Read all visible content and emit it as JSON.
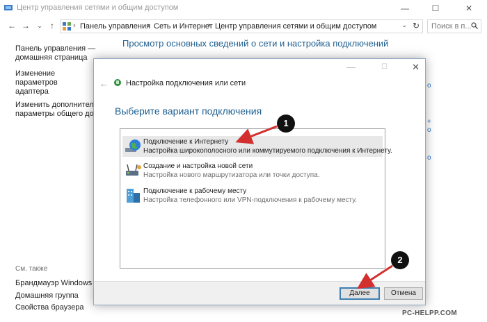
{
  "window": {
    "title": "Центр управления сетями и общим доступом",
    "minimize": "—",
    "maximize": "☐",
    "close": "✕"
  },
  "addressbar": {
    "back": "←",
    "forward": "→",
    "dropdown": "⌄",
    "up": "↑",
    "crumbs": [
      "Панель управления",
      "Сеть и Интернет",
      "Центр управления сетями и общим доступом"
    ],
    "separator": "›",
    "refresh": "↻",
    "search_placeholder": "Поиск в п..."
  },
  "left_pane": {
    "home_link_line1": "Панель управления —",
    "home_link_line2": "домашняя страница",
    "adapter_line1": "Изменение параметров",
    "adapter_line2": "адаптера",
    "sharing_line1": "Изменить дополнительные",
    "sharing_line2": "параметры общего досту",
    "see_also": "См. также",
    "see_also_items": [
      "Брандмауэр Windows",
      "Домашняя группа",
      "Свойства браузера"
    ]
  },
  "main": {
    "heading": "Просмотр основных сведений о сети и настройка подключений"
  },
  "dialog": {
    "minimize": "—",
    "maximize": "☐",
    "close": "✕",
    "back": "←",
    "title": "Настройка подключения или сети",
    "heading": "Выберите вариант подключения",
    "options": [
      {
        "title": "Подключение к Интернету",
        "desc": "Настройка широкополосного или коммутируемого подключения к Интернету.",
        "icon": "globe-network-icon"
      },
      {
        "title": "Создание и настройка новой сети",
        "desc": "Настройка нового маршрутизатора или точки доступа.",
        "icon": "router-icon"
      },
      {
        "title": "Подключение к рабочему месту",
        "desc": "Настройка телефонного или VPN-подключения к рабочему месту.",
        "icon": "workplace-vpn-icon"
      }
    ],
    "next_label": "Далее",
    "cancel_label": "Отмена"
  },
  "annotations": {
    "marker1": "1",
    "marker2": "2",
    "color": "#d32f2f"
  },
  "watermark": "PC-HELPP.COM"
}
